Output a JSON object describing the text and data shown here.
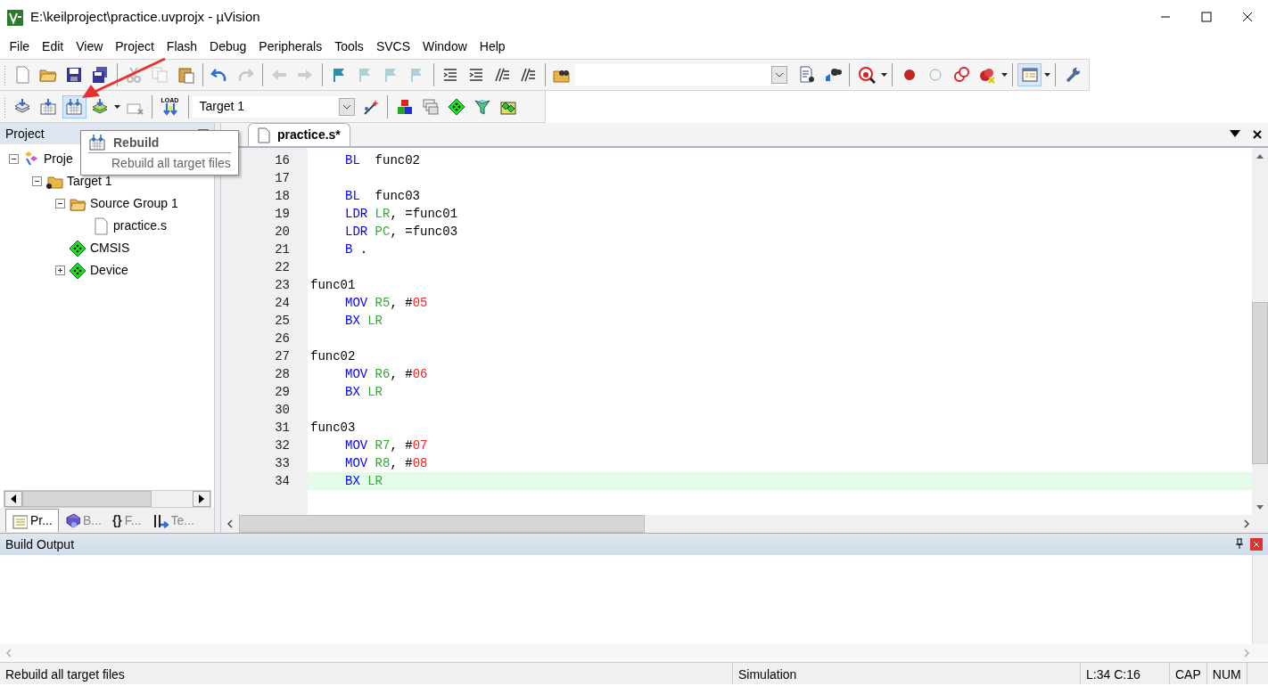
{
  "window": {
    "title": "E:\\keilproject\\practice.uvprojx - µVision"
  },
  "menu": [
    "File",
    "Edit",
    "View",
    "Project",
    "Flash",
    "Debug",
    "Peripherals",
    "Tools",
    "SVCS",
    "Window",
    "Help"
  ],
  "toolbar1": [
    {
      "kind": "new",
      "disabled": false
    },
    {
      "kind": "open",
      "disabled": false
    },
    {
      "kind": "save",
      "disabled": false
    },
    {
      "kind": "saveall",
      "disabled": false
    },
    {
      "kind": "sep"
    },
    {
      "kind": "cut",
      "disabled": true
    },
    {
      "kind": "copy",
      "disabled": true
    },
    {
      "kind": "paste",
      "disabled": false
    },
    {
      "kind": "sep"
    },
    {
      "kind": "undo",
      "disabled": false
    },
    {
      "kind": "redo",
      "disabled": true
    },
    {
      "kind": "sep"
    },
    {
      "kind": "back",
      "disabled": true
    },
    {
      "kind": "forward",
      "disabled": true
    },
    {
      "kind": "sep"
    },
    {
      "kind": "flag",
      "disabled": false
    },
    {
      "kind": "flag",
      "disabled": true
    },
    {
      "kind": "flag",
      "disabled": true
    },
    {
      "kind": "flag",
      "disabled": true
    },
    {
      "kind": "sep"
    },
    {
      "kind": "indent",
      "disabled": false
    },
    {
      "kind": "indent",
      "disabled": false
    },
    {
      "kind": "comment",
      "disabled": false
    },
    {
      "kind": "comment",
      "disabled": false
    },
    {
      "kind": "sep"
    },
    {
      "kind": "findfiles",
      "disabled": false
    },
    {
      "kind": "search"
    },
    {
      "kind": "finddoc",
      "disabled": false
    },
    {
      "kind": "binoculars",
      "disabled": false
    },
    {
      "kind": "sep"
    },
    {
      "kind": "debug",
      "disabled": false
    },
    {
      "kind": "caret"
    },
    {
      "kind": "sep"
    },
    {
      "kind": "breakpoint",
      "disabled": false
    },
    {
      "kind": "breakpoint-off",
      "disabled": false
    },
    {
      "kind": "breakpoint-toggle",
      "disabled": false
    },
    {
      "kind": "breakpoint-kill",
      "disabled": false
    },
    {
      "kind": "caret"
    },
    {
      "kind": "sep"
    },
    {
      "kind": "window",
      "disabled": false,
      "selected": true
    },
    {
      "kind": "caret"
    },
    {
      "kind": "sep"
    },
    {
      "kind": "wrench",
      "disabled": false
    }
  ],
  "toolbar2": [
    {
      "kind": "translate",
      "selected": false
    },
    {
      "kind": "build",
      "selected": false
    },
    {
      "kind": "rebuild",
      "selected": true
    },
    {
      "kind": "batch",
      "selected": false
    },
    {
      "kind": "caret"
    },
    {
      "kind": "stop",
      "selected": false
    },
    {
      "kind": "sep"
    },
    {
      "kind": "load",
      "label": "LOAD",
      "selected": false
    },
    {
      "kind": "sep"
    },
    {
      "kind": "target",
      "value": "Target 1"
    },
    {
      "kind": "wand",
      "selected": false
    },
    {
      "kind": "sep"
    },
    {
      "kind": "blocks",
      "selected": false
    },
    {
      "kind": "windows",
      "selected": false
    },
    {
      "kind": "diamond",
      "selected": false
    },
    {
      "kind": "funnel",
      "selected": false
    },
    {
      "kind": "packs",
      "selected": false
    }
  ],
  "tooltip": {
    "title": "Rebuild",
    "description": "Rebuild all target files"
  },
  "project_panel": {
    "title": "Project",
    "tree": [
      {
        "label": "Proje",
        "kind": "project",
        "expanded": true,
        "children": [
          {
            "label": "Target 1",
            "kind": "target",
            "expanded": true,
            "children": [
              {
                "label": "Source Group 1",
                "kind": "folder",
                "expanded": true,
                "children": [
                  {
                    "label": "practice.s",
                    "kind": "file"
                  }
                ]
              },
              {
                "label": "CMSIS",
                "kind": "component"
              },
              {
                "label": "Device",
                "kind": "component",
                "expanded": false
              }
            ]
          }
        ]
      }
    ],
    "tabs": [
      {
        "label": "Pr...",
        "kind": "project",
        "selected": true
      },
      {
        "label": "B...",
        "kind": "books",
        "selected": false
      },
      {
        "label": "F...",
        "icon": "{}",
        "kind": "functions",
        "selected": false
      },
      {
        "label": "Te...",
        "kind": "templates",
        "selected": false
      }
    ]
  },
  "editor": {
    "tab": "practice.s*",
    "lines": [
      {
        "number": "16",
        "indent": true,
        "current": false,
        "tokens": [
          {
            "kind": "keyword",
            "text": "BL"
          },
          {
            "kind": "plain",
            "text": "  func02"
          }
        ]
      },
      {
        "number": "17",
        "current": false
      },
      {
        "number": "18",
        "indent": true,
        "current": false,
        "tokens": [
          {
            "kind": "keyword",
            "text": "BL"
          },
          {
            "kind": "plain",
            "text": "  func03"
          }
        ]
      },
      {
        "number": "19",
        "indent": true,
        "current": false,
        "tokens": [
          {
            "kind": "keyword",
            "text": "LDR"
          },
          {
            "kind": "register",
            "text": " LR"
          },
          {
            "kind": "plain",
            "text": ", =func01"
          }
        ]
      },
      {
        "number": "20",
        "indent": true,
        "current": false,
        "tokens": [
          {
            "kind": "keyword",
            "text": "LDR"
          },
          {
            "kind": "register",
            "text": " PC"
          },
          {
            "kind": "plain",
            "text": ", =func03"
          }
        ]
      },
      {
        "number": "21",
        "indent": true,
        "current": false,
        "tokens": [
          {
            "kind": "keyword",
            "text": "B"
          },
          {
            "kind": "plain",
            "text": " ."
          }
        ]
      },
      {
        "number": "22",
        "current": false
      },
      {
        "number": "23",
        "indent": false,
        "current": false,
        "tokens": [
          {
            "kind": "plain",
            "text": "func01"
          }
        ]
      },
      {
        "number": "24",
        "indent": true,
        "current": false,
        "tokens": [
          {
            "kind": "keyword",
            "text": "MOV"
          },
          {
            "kind": "register",
            "text": " R5"
          },
          {
            "kind": "plain",
            "text": ", #"
          },
          {
            "kind": "number",
            "text": "05"
          }
        ]
      },
      {
        "number": "25",
        "indent": true,
        "current": false,
        "tokens": [
          {
            "kind": "keyword",
            "text": "BX"
          },
          {
            "kind": "register",
            "text": " LR"
          }
        ]
      },
      {
        "number": "26",
        "current": false
      },
      {
        "number": "27",
        "indent": false,
        "current": false,
        "tokens": [
          {
            "kind": "plain",
            "text": "func02"
          }
        ]
      },
      {
        "number": "28",
        "indent": true,
        "current": false,
        "tokens": [
          {
            "kind": "keyword",
            "text": "MOV"
          },
          {
            "kind": "register",
            "text": " R6"
          },
          {
            "kind": "plain",
            "text": ", #"
          },
          {
            "kind": "number",
            "text": "06"
          }
        ]
      },
      {
        "number": "29",
        "indent": true,
        "current": false,
        "tokens": [
          {
            "kind": "keyword",
            "text": "BX"
          },
          {
            "kind": "register",
            "text": " LR"
          }
        ]
      },
      {
        "number": "30",
        "current": false
      },
      {
        "number": "31",
        "indent": false,
        "current": false,
        "tokens": [
          {
            "kind": "plain",
            "text": "func03"
          }
        ]
      },
      {
        "number": "32",
        "indent": true,
        "current": false,
        "tokens": [
          {
            "kind": "keyword",
            "text": "MOV"
          },
          {
            "kind": "register",
            "text": " R7"
          },
          {
            "kind": "plain",
            "text": ", #"
          },
          {
            "kind": "number",
            "text": "07"
          }
        ]
      },
      {
        "number": "33",
        "indent": true,
        "current": false,
        "tokens": [
          {
            "kind": "keyword",
            "text": "MOV"
          },
          {
            "kind": "register",
            "text": " R8"
          },
          {
            "kind": "plain",
            "text": ", #"
          },
          {
            "kind": "number",
            "text": "08"
          }
        ]
      },
      {
        "number": "34",
        "indent": true,
        "current": true,
        "tokens": [
          {
            "kind": "keyword",
            "text": "BX"
          },
          {
            "kind": "register",
            "text": " LR"
          }
        ]
      }
    ]
  },
  "build_output": {
    "title": "Build Output"
  },
  "status_bar": {
    "message": "Rebuild all target files",
    "mode": "Simulation",
    "position": "L:34 C:16",
    "caps": "CAP",
    "num": "NUM"
  }
}
